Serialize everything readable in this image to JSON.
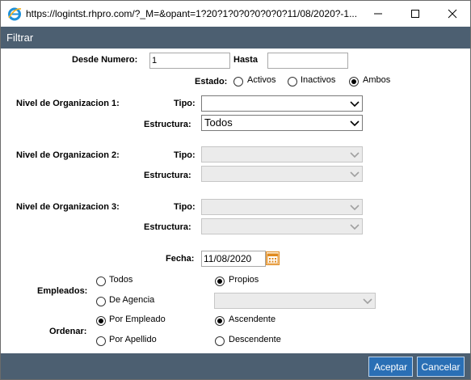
{
  "window": {
    "url": "https://logintst.rhpro.com/?_M=&opant=1?20?1?0?0?0?0?0?11/08/2020?-1...",
    "icons": [
      "ie-icon",
      "minimize-icon",
      "maximize-icon",
      "close-icon"
    ]
  },
  "header": {
    "title": "Filtrar"
  },
  "form": {
    "desde_label": "Desde Numero:",
    "desde_value": "1",
    "hasta_label": "Hasta",
    "hasta_value": "",
    "estado_label": "Estado:",
    "estado_options": [
      "Activos",
      "Inactivos",
      "Ambos"
    ],
    "estado_selected": "Ambos",
    "nivel1_label": "Nivel de Organizacion 1:",
    "nivel2_label": "Nivel de Organizacion 2:",
    "nivel3_label": "Nivel de Organizacion 3:",
    "tipo_label": "Tipo:",
    "estructura_label": "Estructura:",
    "nivel1_tipo": "",
    "nivel1_estructura": "Todos",
    "fecha_label": "Fecha:",
    "fecha_value": "11/08/2020",
    "empleados_label": "Empleados:",
    "empleados_todos": "Todos",
    "empleados_propios": "Propios",
    "empleados_agencia": "De Agencia",
    "empleados_selected": "Propios",
    "ordenar_label": "Ordenar:",
    "ordenar_empleado": "Por Empleado",
    "ordenar_apellido": "Por Apellido",
    "ordenar_selected": "Por Empleado",
    "orden_ascendente": "Ascendente",
    "orden_descendente": "Descendente",
    "orden_selected": "Ascendente"
  },
  "footer": {
    "aceptar": "Aceptar",
    "cancelar": "Cancelar"
  },
  "colors": {
    "header_bg": "#4c5f71",
    "button_bg": "#2a6fb5",
    "calendar_accent": "#e08a1e"
  }
}
